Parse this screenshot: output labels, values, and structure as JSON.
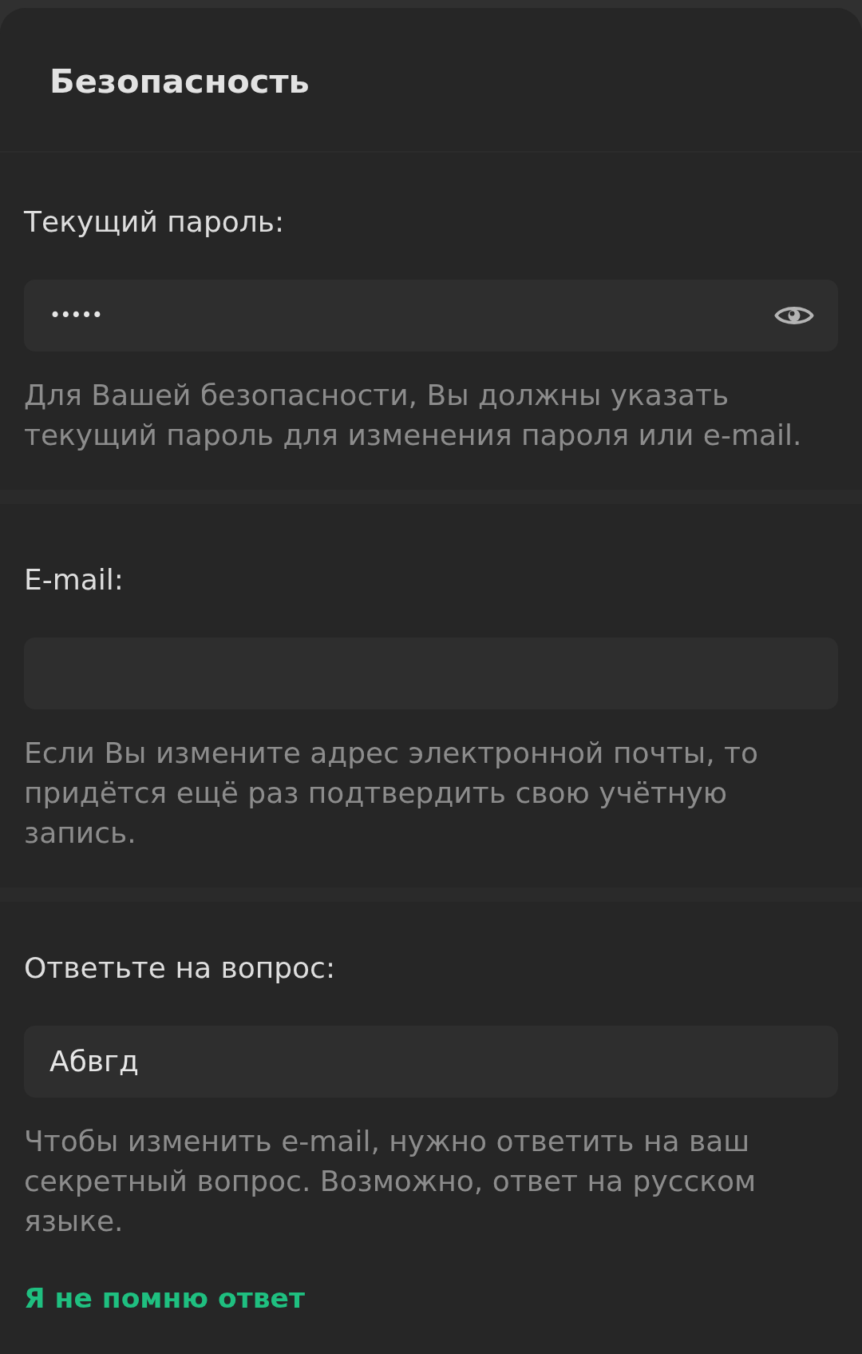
{
  "header": {
    "title": "Безопасность"
  },
  "sections": [
    {
      "label": "Текущий пароль:",
      "field": {
        "kind": "password",
        "value": "•••••"
      },
      "hint": "Для Вашей безопасности, Вы должны указать текущий пароль для изменения пароля или e-mail."
    },
    {
      "label": "E-mail:",
      "field": {
        "kind": "text"
      },
      "hint": "Если Вы измените адрес электронной почты, то придётся ещё раз подтвердить свою учётную запись."
    },
    {
      "label": "Ответьте на вопрос:",
      "field": {
        "kind": "text",
        "value": "Абвгд"
      },
      "hint": "Чтобы изменить e-mail, нужно ответить на ваш секретный вопрос. Возможно, ответ на русском языке.",
      "link": "Я не помню ответ"
    }
  ]
}
